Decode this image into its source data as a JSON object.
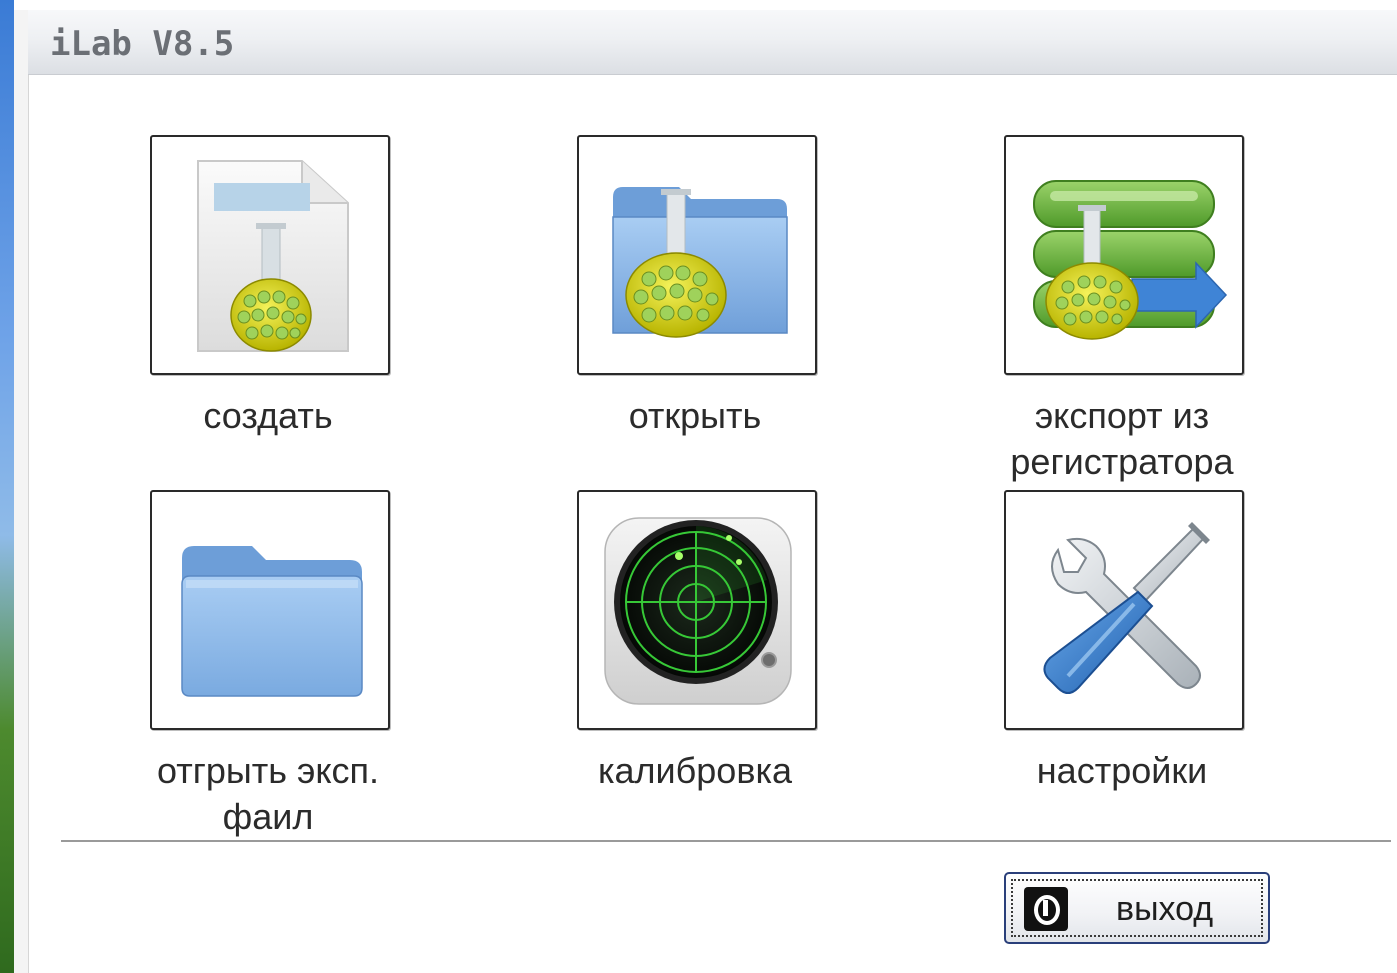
{
  "window": {
    "title": "iLab V8.5"
  },
  "tiles": [
    {
      "label": "создать",
      "icon": "new-file-flask-icon"
    },
    {
      "label": "открыть",
      "icon": "open-folder-flask-icon"
    },
    {
      "label_line1": "экспорт из",
      "label_line2": "регистратора",
      "icon": "export-database-flask-icon"
    },
    {
      "label": "отгрыть эксп. фаил",
      "icon": "folder-icon"
    },
    {
      "label": "калибровка",
      "icon": "radar-icon"
    },
    {
      "label": "настройки",
      "icon": "tools-icon"
    }
  ],
  "footer": {
    "exit_label": "выход",
    "exit_icon": "power-icon"
  },
  "colors": {
    "tile_border": "#2a2a2a",
    "flask_liquid": "#e6e400",
    "folder_blue": "#8ab8ea",
    "export_green": "#6db33f",
    "radar_green": "#3cd23c"
  }
}
